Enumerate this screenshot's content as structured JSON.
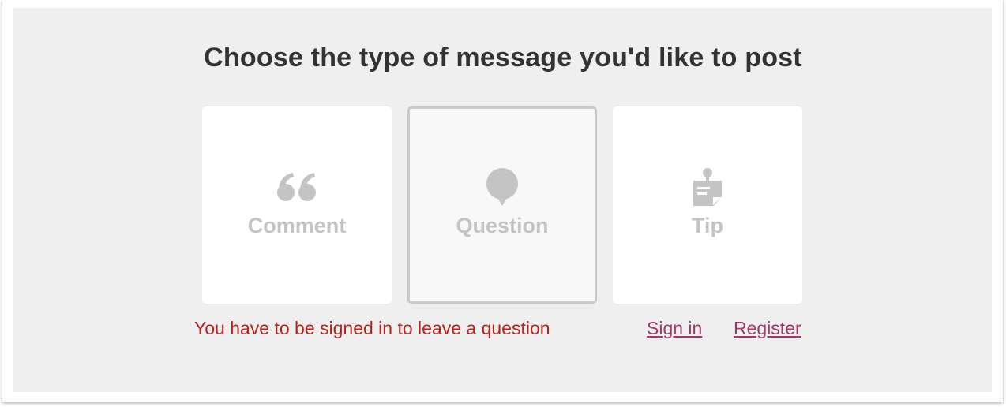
{
  "heading": "Choose the type of message you'd like to post",
  "types": [
    {
      "label": "Comment",
      "icon": "quote-icon",
      "selected": false
    },
    {
      "label": "Question",
      "icon": "speech-bubble-icon",
      "selected": true
    },
    {
      "label": "Tip",
      "icon": "tip-note-icon",
      "selected": false
    }
  ],
  "notice": "You have to be signed in to leave a question",
  "links": {
    "sign_in": "Sign in",
    "register": "Register"
  },
  "colors": {
    "panel_bg": "#efefef",
    "card_bg": "#ffffff",
    "icon_gray": "#c4c4c4",
    "notice_red": "#b5231d",
    "link_pink": "#a3386a",
    "heading": "#333333"
  }
}
